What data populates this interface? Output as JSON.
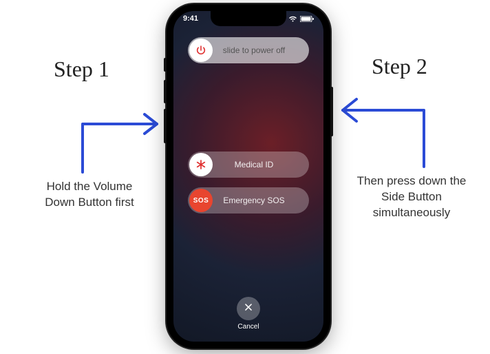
{
  "statusbar": {
    "time": "9:41"
  },
  "sliders": {
    "power": {
      "label": "slide to power off",
      "icon": "power-icon"
    },
    "medical": {
      "label": "Medical ID",
      "icon": "asterisk-icon"
    },
    "sos": {
      "label": "Emergency SOS",
      "icon_text": "SOS"
    }
  },
  "cancel": {
    "label": "Cancel"
  },
  "annotations": {
    "step1": {
      "title": "Step 1",
      "desc": "Hold the Volume Down Button first"
    },
    "step2": {
      "title": "Step 2",
      "desc": "Then press down the Side Button simultaneously"
    }
  },
  "colors": {
    "arrow": "#2b4bd6",
    "sos": "#e8452f",
    "power_icon": "#e03131"
  }
}
